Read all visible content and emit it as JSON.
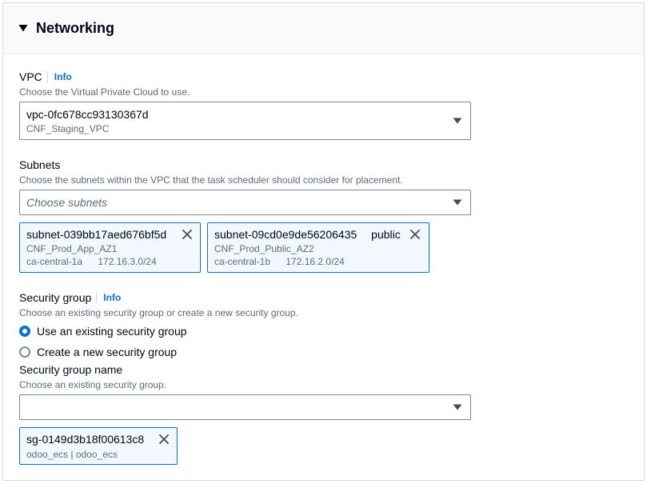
{
  "colors": {
    "text": "#000716",
    "secondary": "#5f6b7a",
    "link": "#0972d3",
    "icon": "#414d5c",
    "token_bg": "#f2f8fd",
    "token_border": "#0972d3",
    "radio_checked": "#0972d3"
  },
  "icons": {
    "section_toggle": "caret-down-icon",
    "select_dropdown": "caret-down-icon",
    "token_dismiss": "close-icon"
  },
  "networking": {
    "title": "Networking",
    "vpc": {
      "label": "VPC",
      "info": "Info",
      "description": "Choose the Virtual Private Cloud to use.",
      "selected": {
        "id": "vpc-0fc678cc93130367d",
        "name": "CNF_Staging_VPC"
      }
    },
    "subnets": {
      "label": "Subnets",
      "description": "Choose the subnets within the VPC that the task scheduler should consider for placement.",
      "placeholder": "Choose subnets",
      "selected": [
        {
          "id": "subnet-039bb17aed676bf5d",
          "name": "CNF_Prod_App_AZ1",
          "availability_zone": "ca-central-1a",
          "cidr": "172.16.3.0/24"
        },
        {
          "id": "subnet-09cd0e9de56206435",
          "tag": "public",
          "name": "CNF_Prod_Public_AZ2",
          "availability_zone": "ca-central-1b",
          "cidr": "172.16.2.0/24"
        }
      ]
    },
    "security_group": {
      "label": "Security group",
      "info": "Info",
      "description": "Choose an existing security group or create a new security group.",
      "options": [
        {
          "label": "Use an existing security group",
          "checked": true
        },
        {
          "label": "Create a new security group",
          "checked": false
        }
      ],
      "name_field": {
        "label": "Security group name",
        "description": "Choose an existing security group.",
        "value": "",
        "selected": [
          {
            "id": "sg-0149d3b18f00613c8",
            "name": "odoo_ecs | odoo_ecs"
          }
        ]
      }
    }
  }
}
